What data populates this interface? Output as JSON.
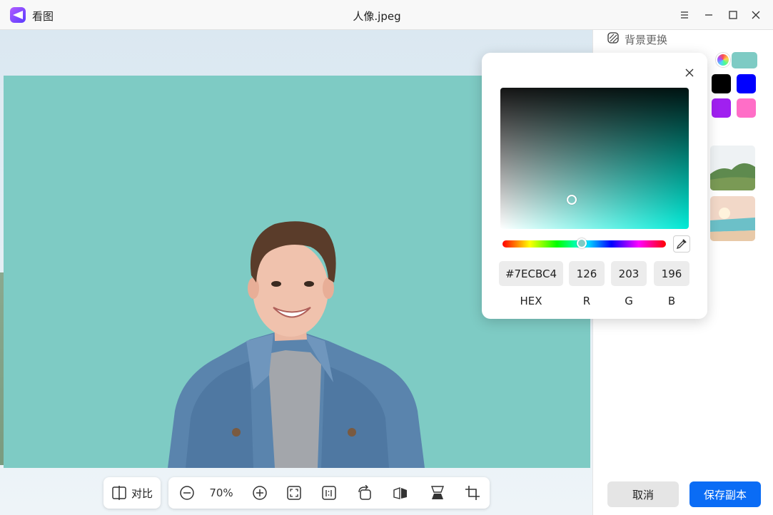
{
  "window": {
    "app_name": "看图",
    "document_title": "人像.jpeg"
  },
  "toolbar": {
    "compare_label": "对比",
    "zoom": "70%"
  },
  "panel": {
    "title": "背景更换",
    "cancel_label": "取消",
    "save_label": "保存副本",
    "swatches": {
      "selected": "#7ecbc4",
      "black": "#000000",
      "blue": "#0000ff",
      "purple": "#a020f0",
      "pink": "#ff6ec7"
    }
  },
  "picker": {
    "hex_value": "#7ECBC4",
    "r_value": "126",
    "g_value": "203",
    "b_value": "196",
    "hex_label": "HEX",
    "r_label": "R",
    "g_label": "G",
    "b_label": "B",
    "hue_fraction": 0.485
  },
  "photo": {
    "background_color": "#7ecbc4"
  }
}
